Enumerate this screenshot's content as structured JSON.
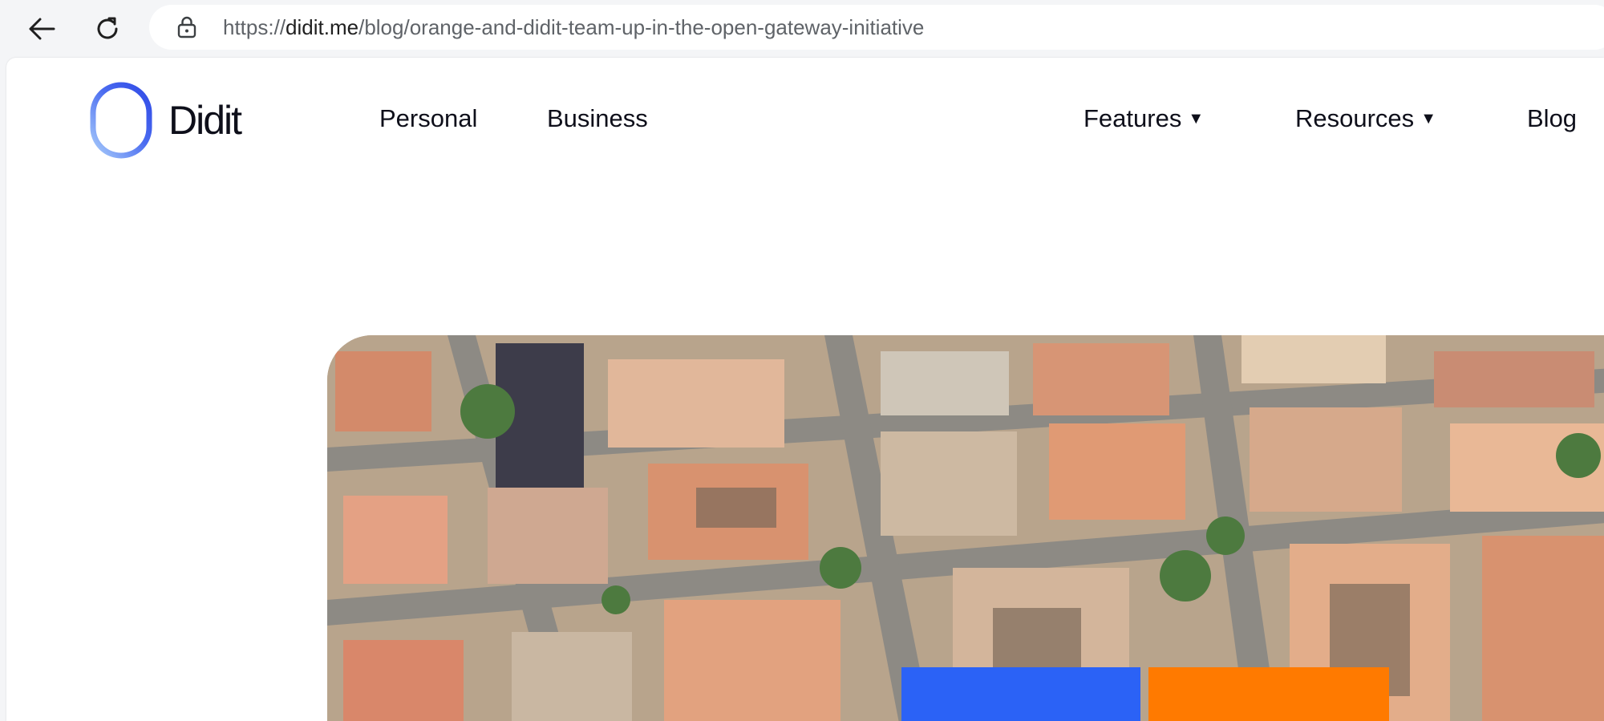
{
  "browser": {
    "url_prefix": "https://",
    "url_host": "didit.me",
    "url_path": "/blog/orange-and-didit-team-up-in-the-open-gateway-initiative",
    "icons": [
      "back-arrow-icon",
      "reload-icon",
      "lock-icon"
    ]
  },
  "site": {
    "logo_text": "Didit",
    "nav": {
      "personal": "Personal",
      "business": "Business",
      "features": "Features",
      "resources": "Resources",
      "blog": "Blog",
      "caret": "▼"
    }
  },
  "hero": {
    "image": "aerial-city-photo",
    "colors": {
      "blue": "#2b62f6",
      "orange": "#ff7a00"
    }
  }
}
